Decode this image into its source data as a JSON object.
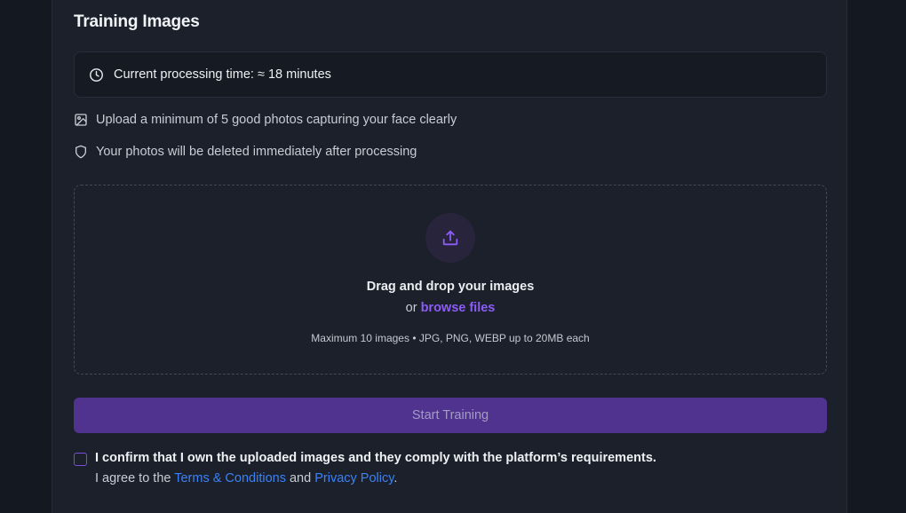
{
  "section": {
    "title": "Training Images"
  },
  "processing": {
    "icon": "clock-icon",
    "text": "Current processing time: ≈ 18 minutes"
  },
  "info": [
    {
      "icon": "image-icon",
      "text": "Upload a minimum of 5 good photos capturing your face clearly"
    },
    {
      "icon": "shield-icon",
      "text": "Your photos will be deleted immediately after processing"
    }
  ],
  "dropzone": {
    "icon": "upload-icon",
    "title": "Drag and drop your images",
    "or_text": "or",
    "browse_label": "browse files",
    "limits": "Maximum 10 images • JPG, PNG, WEBP up to 20MB each"
  },
  "actions": {
    "start_label": "Start Training",
    "start_disabled": true
  },
  "consent": {
    "checked": false,
    "confirm": "I confirm that I own the uploaded images and they comply with the platform’s requirements.",
    "agree_prefix": "I agree to the",
    "terms_label": "Terms & Conditions",
    "and_text": "and",
    "privacy_label": "Privacy Policy",
    "suffix": "."
  },
  "colors": {
    "accent": "#8b5cf6",
    "button_bg": "#4f338f",
    "link": "#3b82f6",
    "panel_bg": "#1b202b",
    "page_bg": "#141820"
  }
}
